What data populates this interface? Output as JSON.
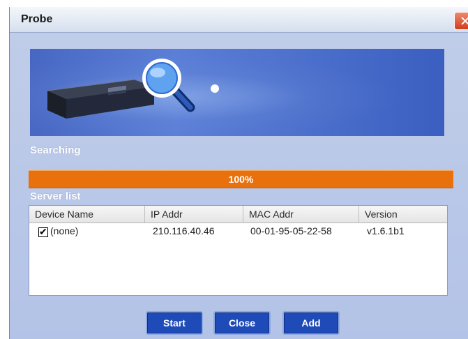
{
  "window": {
    "title": "Probe"
  },
  "labels": {
    "searching": "Searching",
    "server_list": "Server list"
  },
  "progress": {
    "value": 1.0,
    "text": "100%",
    "color": "#e8710e"
  },
  "table": {
    "columns": [
      "Device Name",
      "IP Addr",
      "MAC Addr",
      "Version"
    ],
    "rows": [
      {
        "checked": true,
        "device": "(none)",
        "ip": "210.116.40.46",
        "mac": "00-01-95-05-22-58",
        "version": "v1.6.1b1"
      }
    ]
  },
  "buttons": {
    "start": "Start",
    "close": "Close",
    "add": "Add"
  },
  "colors": {
    "accent": "#1f4bb8",
    "client_bg": "#b8c8e8",
    "banner": "#4767c3"
  },
  "icons": {
    "banner": [
      "network-switch-icon",
      "magnifier-icon"
    ],
    "close": "close-icon"
  }
}
